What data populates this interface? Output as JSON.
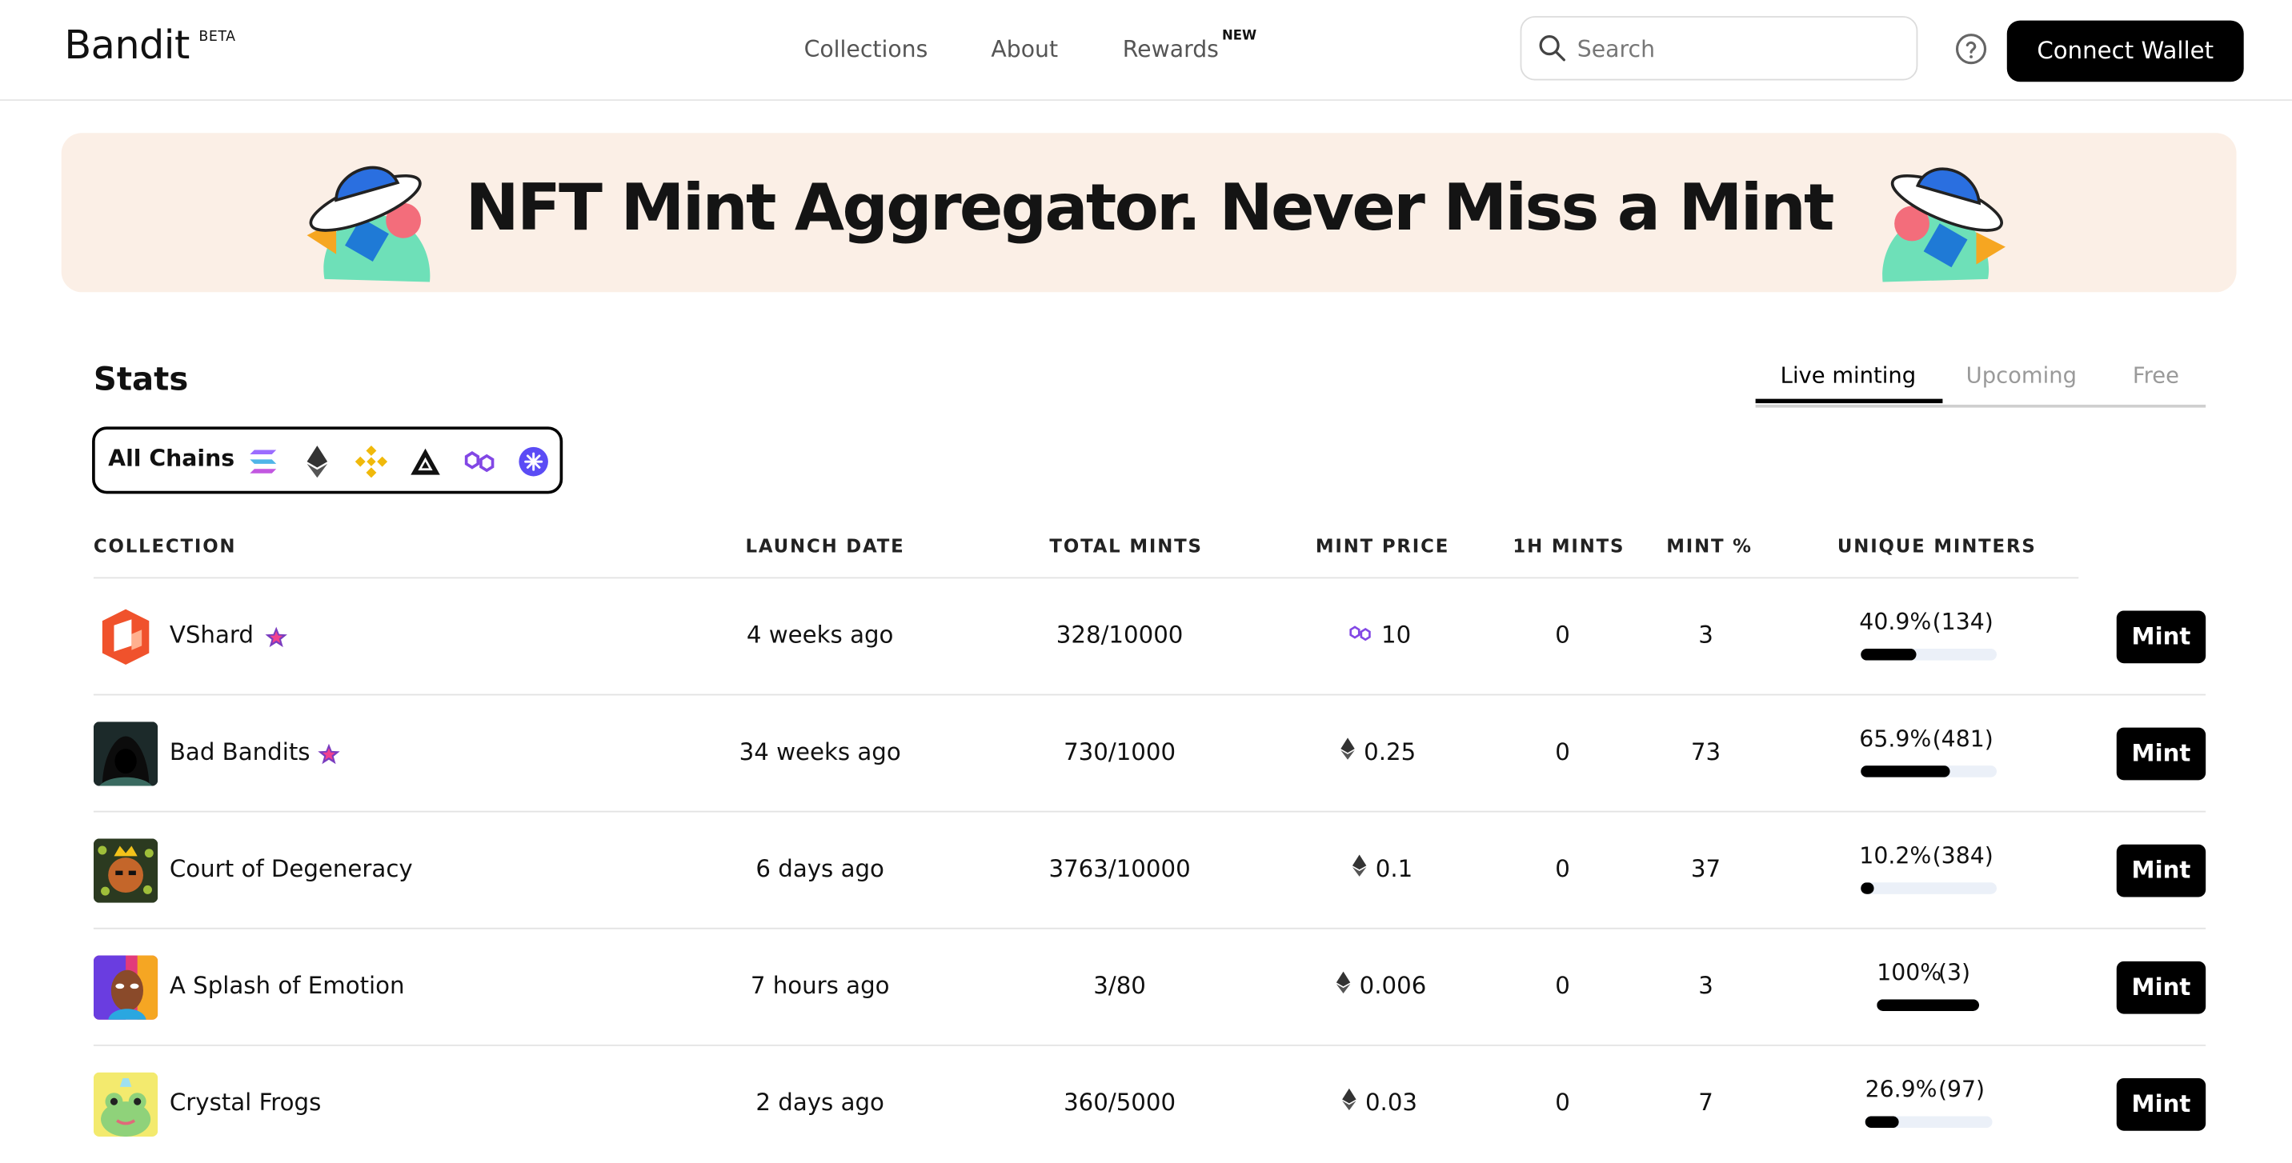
{
  "header": {
    "logo": "Bandit",
    "beta": "BETA",
    "nav": [
      {
        "label": "Collections"
      },
      {
        "label": "About"
      },
      {
        "label": "Rewards",
        "badge": "NEW"
      }
    ],
    "search_placeholder": "Search",
    "help_icon": "question-circle-icon",
    "connect_wallet": "Connect Wallet"
  },
  "banner": {
    "text": "NFT Mint Aggregator. Never Miss a Mint"
  },
  "stats": {
    "title": "Stats",
    "tabs": [
      {
        "label": "Live minting",
        "active": true
      },
      {
        "label": "Upcoming",
        "active": false
      },
      {
        "label": "Free",
        "active": false
      }
    ],
    "chain_filter": {
      "label": "All Chains",
      "chains": [
        "solana-icon",
        "ethereum-icon",
        "bnb-icon",
        "arbitrum-icon",
        "polygon-icon",
        "starknet-icon"
      ]
    }
  },
  "table": {
    "columns": [
      "COLLECTION",
      "LAUNCH DATE",
      "TOTAL MINTS",
      "MINT PRICE",
      "1H MINTS",
      "MINT %",
      "UNIQUE MINTERS"
    ],
    "rows": [
      {
        "name": "VShard",
        "featured": true,
        "launch": "4 weeks ago",
        "total": "328/10000",
        "chain": "polygon",
        "price": "10",
        "h1": "0",
        "mintpct": "3",
        "unique_pct": "40.9%",
        "unique_count": "(134)",
        "progress": 0.409,
        "action": "Mint"
      },
      {
        "name": "Bad Bandits",
        "featured": true,
        "launch": "34 weeks ago",
        "total": "730/1000",
        "chain": "ethereum",
        "price": "0.25",
        "h1": "0",
        "mintpct": "73",
        "unique_pct": "65.9%",
        "unique_count": "(481)",
        "progress": 0.659,
        "action": "Mint"
      },
      {
        "name": "Court of Degeneracy",
        "featured": false,
        "launch": "6 days ago",
        "total": "3763/10000",
        "chain": "ethereum",
        "price": "0.1",
        "h1": "0",
        "mintpct": "37",
        "unique_pct": "10.2%",
        "unique_count": "(384)",
        "progress": 0.102,
        "action": "Mint"
      },
      {
        "name": "A Splash of Emotion",
        "featured": false,
        "launch": "7 hours ago",
        "total": "3/80",
        "chain": "ethereum",
        "price": "0.006",
        "h1": "0",
        "mintpct": "3",
        "unique_pct": "100%",
        "unique_count": "(3)",
        "progress": 1.0,
        "action": "Mint"
      },
      {
        "name": "Crystal Frogs",
        "featured": false,
        "launch": "2 days ago",
        "total": "360/5000",
        "chain": "ethereum",
        "price": "0.03",
        "h1": "0",
        "mintpct": "7",
        "unique_pct": "26.9%",
        "unique_count": "(97)",
        "progress": 0.269,
        "action": "Mint"
      }
    ]
  },
  "colors": {
    "banner_bg": "#fbefe6",
    "button_bg": "#000000",
    "progress_track": "#ebf0f8",
    "featured_star": "#7a3dbf",
    "polygon": "#8247e5"
  }
}
